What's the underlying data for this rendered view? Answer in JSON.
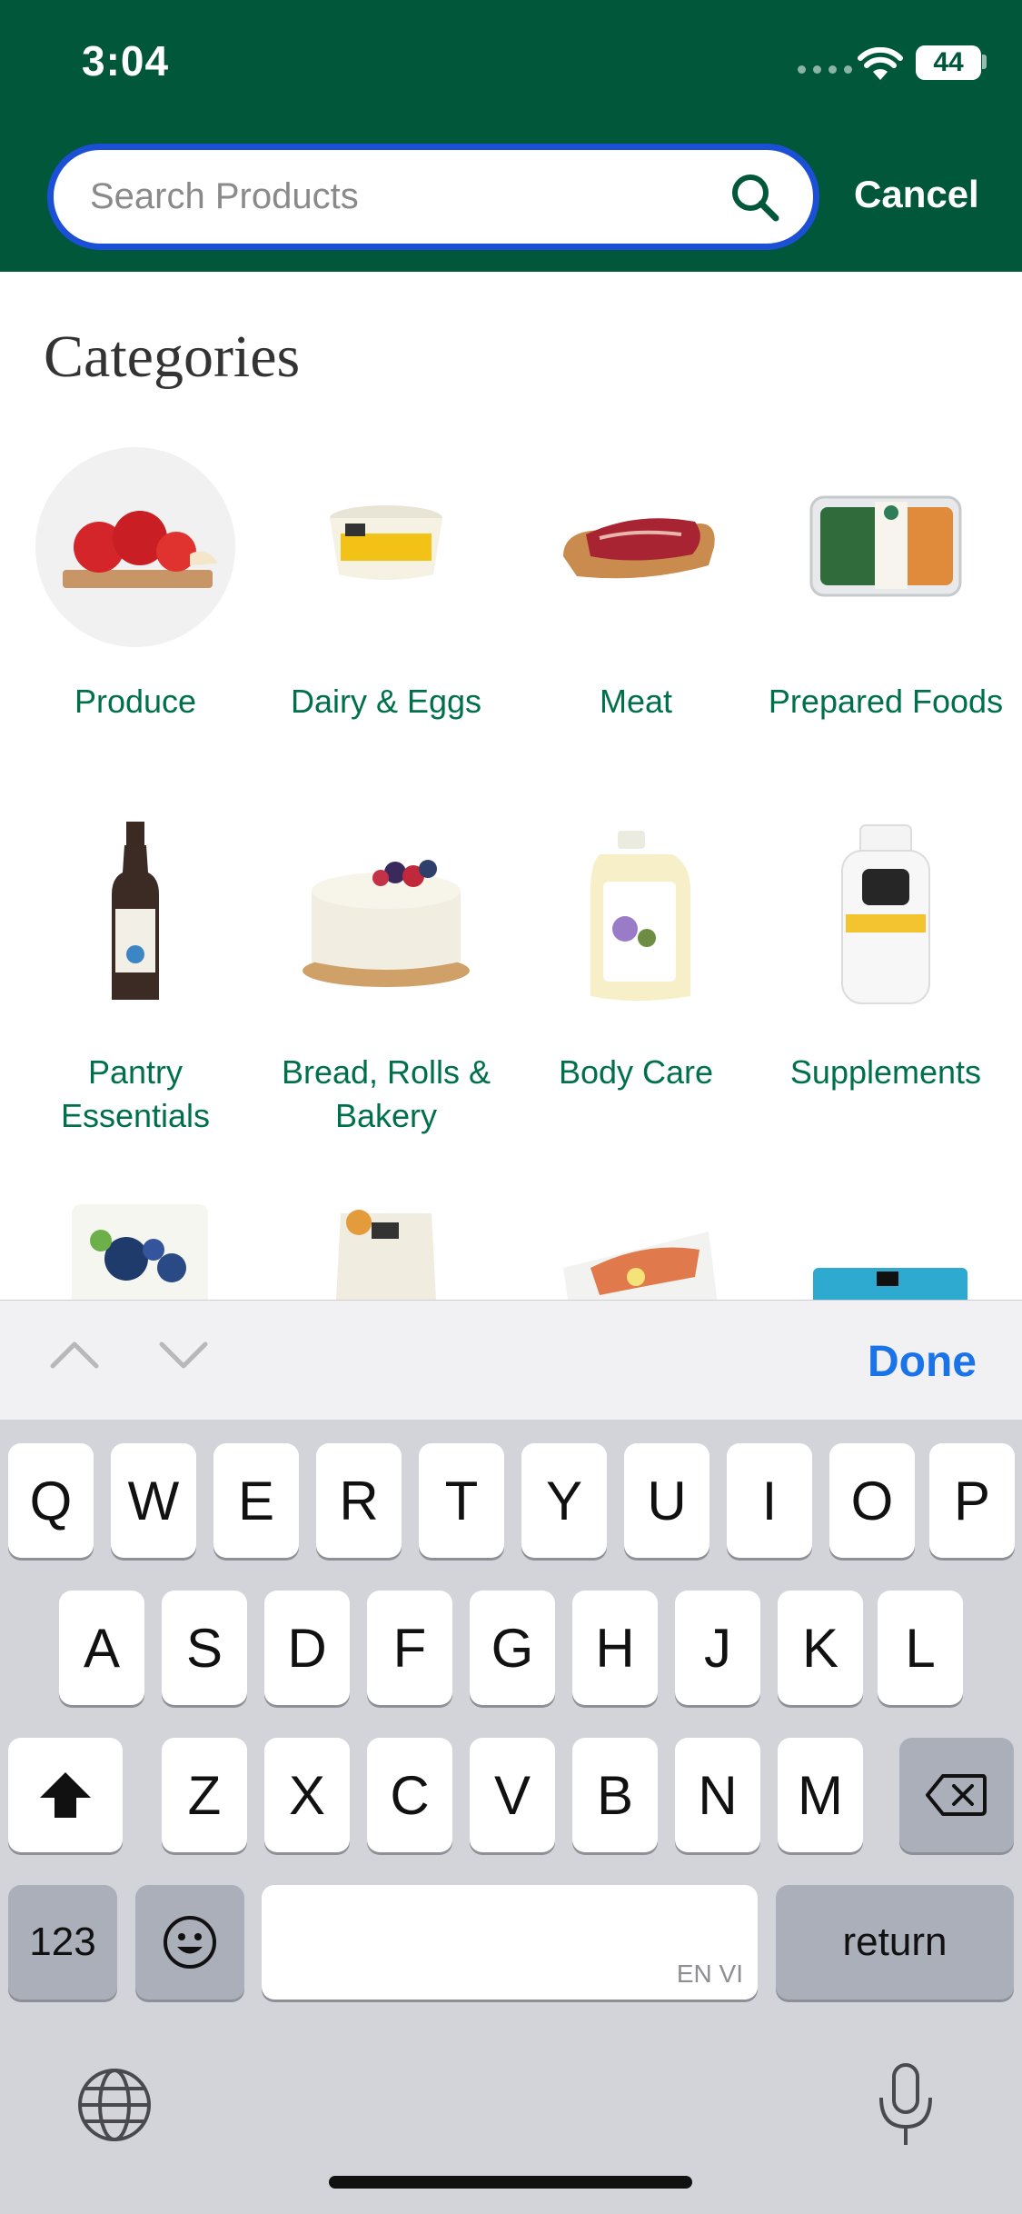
{
  "status": {
    "time": "3:04",
    "battery": "44"
  },
  "search": {
    "placeholder": "Search Products",
    "cancel_label": "Cancel"
  },
  "categories": {
    "title": "Categories",
    "items": [
      {
        "label": "Produce",
        "icon": "apples-icon"
      },
      {
        "label": "Dairy & Eggs",
        "icon": "parmesan-tub-icon"
      },
      {
        "label": "Meat",
        "icon": "steak-icon"
      },
      {
        "label": "Prepared Foods",
        "icon": "prepared-meal-icon"
      },
      {
        "label": "Pantry Essentials",
        "icon": "olive-oil-icon"
      },
      {
        "label": "Bread, Rolls & Bakery",
        "icon": "cake-icon"
      },
      {
        "label": "Body Care",
        "icon": "soap-jug-icon"
      },
      {
        "label": "Supplements",
        "icon": "vitamin-bottle-icon"
      }
    ]
  },
  "keyboard": {
    "done_label": "Done",
    "row1": [
      "Q",
      "W",
      "E",
      "R",
      "T",
      "Y",
      "U",
      "I",
      "O",
      "P"
    ],
    "row2": [
      "A",
      "S",
      "D",
      "F",
      "G",
      "H",
      "J",
      "K",
      "L"
    ],
    "row3": [
      "Z",
      "X",
      "C",
      "V",
      "B",
      "N",
      "M"
    ],
    "numbers_label": "123",
    "return_label": "return",
    "space_hint": "EN VI"
  },
  "colors": {
    "header": "#00573a",
    "accent": "#00704a",
    "focus_ring": "#1a4fd6",
    "done": "#1a73e8"
  }
}
